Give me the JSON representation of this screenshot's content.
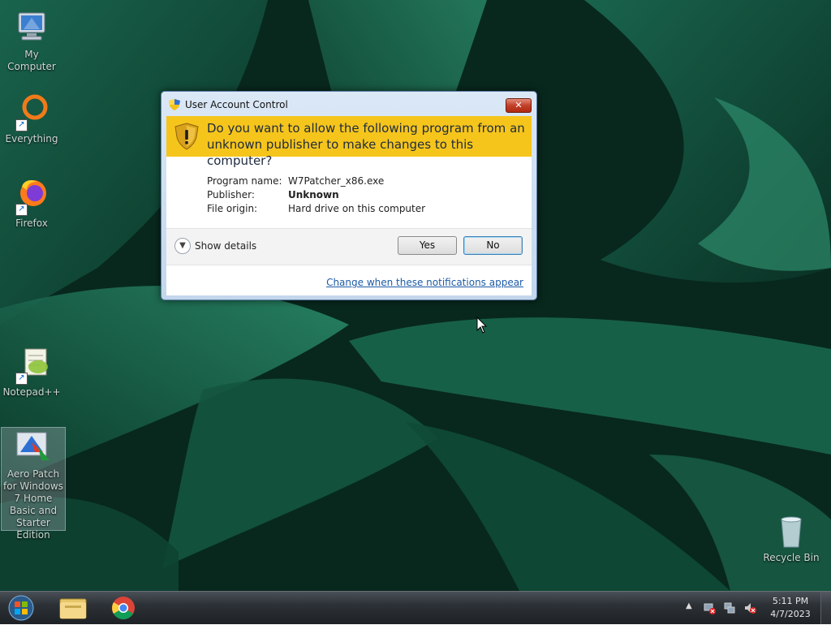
{
  "desktop": {
    "icons": [
      {
        "label": "My Computer",
        "icon": "computer-icon"
      },
      {
        "label": "Everything",
        "icon": "everything-icon"
      },
      {
        "label": "Firefox",
        "icon": "firefox-icon"
      },
      {
        "label": "Notepad++",
        "icon": "notepad-plus-plus-icon"
      },
      {
        "label": "Aero Patch for Windows 7 Home Basic and Starter Edition",
        "icon": "aero-patch-icon",
        "selected": true
      },
      {
        "label": "Recycle Bin",
        "icon": "recycle-bin-icon"
      }
    ]
  },
  "uac": {
    "title": "User Account Control",
    "close_label": "✕",
    "question": "Do you want to allow the following program from an unknown publisher to make changes to this computer?",
    "program_name_label": "Program name:",
    "program_name_value": "W7Patcher_x86.exe",
    "publisher_label": "Publisher:",
    "publisher_value": "Unknown",
    "file_origin_label": "File origin:",
    "file_origin_value": "Hard drive on this computer",
    "show_details_label": "Show details",
    "yes_label": "Yes",
    "no_label": "No",
    "change_link": "Change when these notifications appear"
  },
  "taskbar": {
    "pinned": [
      "windows-explorer-icon",
      "chrome-icon"
    ],
    "tray_icons": [
      "network-error-icon",
      "network-icon",
      "volume-muted-icon"
    ],
    "time": "5:11 PM",
    "date": "4/7/2023"
  },
  "colors": {
    "uac_banner": "#f6c51c",
    "link": "#1c5aa6",
    "wallpaper": "#0d3a2a"
  }
}
